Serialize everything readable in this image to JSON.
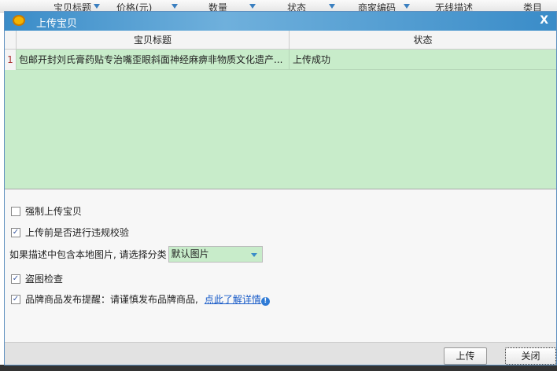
{
  "background_table": {
    "columns": [
      "宝贝标题",
      "价格(元)",
      "数量",
      "状态",
      "商家编码",
      "无线描述",
      "类目"
    ]
  },
  "dialog": {
    "title": "上传宝贝",
    "close_glyph": "X",
    "grid": {
      "columns": [
        "宝贝标题",
        "状态"
      ],
      "rows": [
        {
          "num": "1",
          "title": "包邮开封刘氏膏药贴专治嘴歪眼斜面神经麻痹非物质文化遗产...",
          "status": "上传成功"
        }
      ]
    },
    "options": {
      "force_upload": {
        "label": "强制上传宝贝",
        "checked": false
      },
      "violation_check": {
        "label": "上传前是否进行违规校验",
        "checked": true
      },
      "category_label": "如果描述中包含本地图片, 请选择分类",
      "category_value": "默认图片",
      "image_theft_check": {
        "label": "盗图检查",
        "checked": true
      },
      "brand_notice": {
        "label": "品牌商品发布提醒：请谨慎发布品牌商品,",
        "checked": true,
        "link": "点此了解详情"
      }
    },
    "buttons": {
      "upload": "上传",
      "close": "关闭"
    }
  },
  "check_glyph": "✓",
  "info_glyph": "!"
}
